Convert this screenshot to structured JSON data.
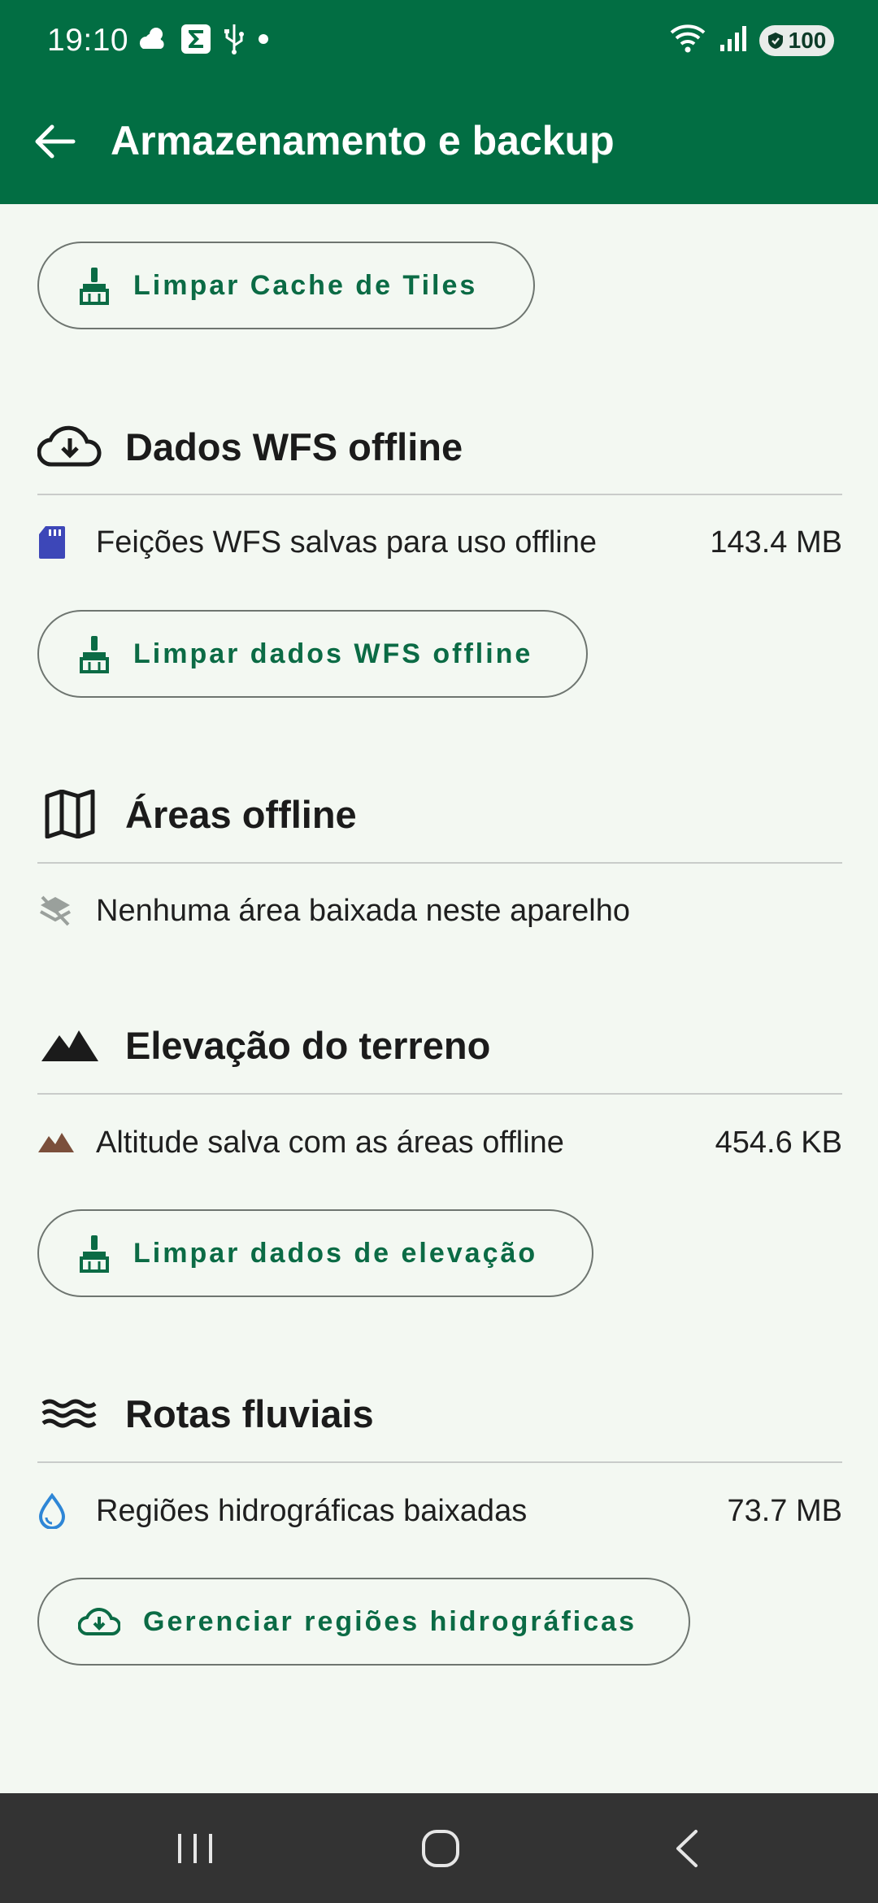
{
  "status_bar": {
    "time": "19:10",
    "left_icons": [
      "weather-icon",
      "sigma-app-icon",
      "usb-icon",
      "dot-icon"
    ],
    "right_icons": [
      "wifi-icon",
      "signal-icon"
    ],
    "battery": "100"
  },
  "app_bar": {
    "title": "Armazenamento e backup",
    "back_icon": "arrow-left-icon",
    "color": "#026e43"
  },
  "tiles": {
    "clear_button": "Limpar Cache de Tiles"
  },
  "wfs": {
    "title": "Dados WFS offline",
    "row_label": "Feições WFS salvas para uso offline",
    "row_value": "143.4 MB",
    "clear_button": "Limpar dados WFS offline"
  },
  "areas": {
    "title": "Áreas offline",
    "row_label": "Nenhuma área baixada neste aparelho"
  },
  "elevation": {
    "title": "Elevação do terreno",
    "row_label": "Altitude salva com as áreas offline",
    "row_value": "454.6 KB",
    "clear_button": "Limpar dados de elevação"
  },
  "rivers": {
    "title": "Rotas fluviais",
    "row_label": "Regiões hidrográficas baixadas",
    "row_value": "73.7 MB",
    "manage_button": "Gerenciar regiões hidrográficas"
  },
  "nav_bar": {
    "items": [
      "recent-apps-icon",
      "home-icon",
      "back-icon"
    ]
  }
}
